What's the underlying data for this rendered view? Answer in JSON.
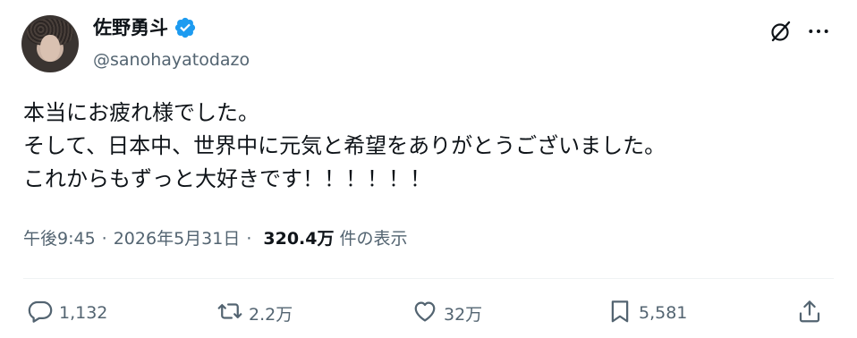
{
  "user": {
    "display_name": "佐野勇斗",
    "handle": "@sanohayatodazo",
    "verified_icon": "verified-badge-icon",
    "avatar": "avatar-photo"
  },
  "header_icons": [
    "grok-icon",
    "more-icon"
  ],
  "tweet": {
    "lines": [
      "本当にお疲れ様でした。",
      "そして、日本中、世界中に元気と希望をありがとうございました。",
      "これからもずっと大好きです！！！！！！"
    ]
  },
  "meta": {
    "time": "午後9:45",
    "separator": "·",
    "date": "2026年5月31日",
    "views": "320.4万",
    "views_label": "件の表示"
  },
  "actions": {
    "reply": {
      "icon": "reply-icon",
      "count": "1,132"
    },
    "repost": {
      "icon": "repost-icon",
      "count": "2.2万"
    },
    "like": {
      "icon": "heart-icon",
      "count": "32万"
    },
    "bookmark": {
      "icon": "bookmark-icon",
      "count": "5,581"
    },
    "share": {
      "icon": "share-icon"
    }
  },
  "colors": {
    "text": "#0f1419",
    "secondary": "#536471",
    "verified": "#1d9bf0",
    "divider": "#eff3f4"
  }
}
